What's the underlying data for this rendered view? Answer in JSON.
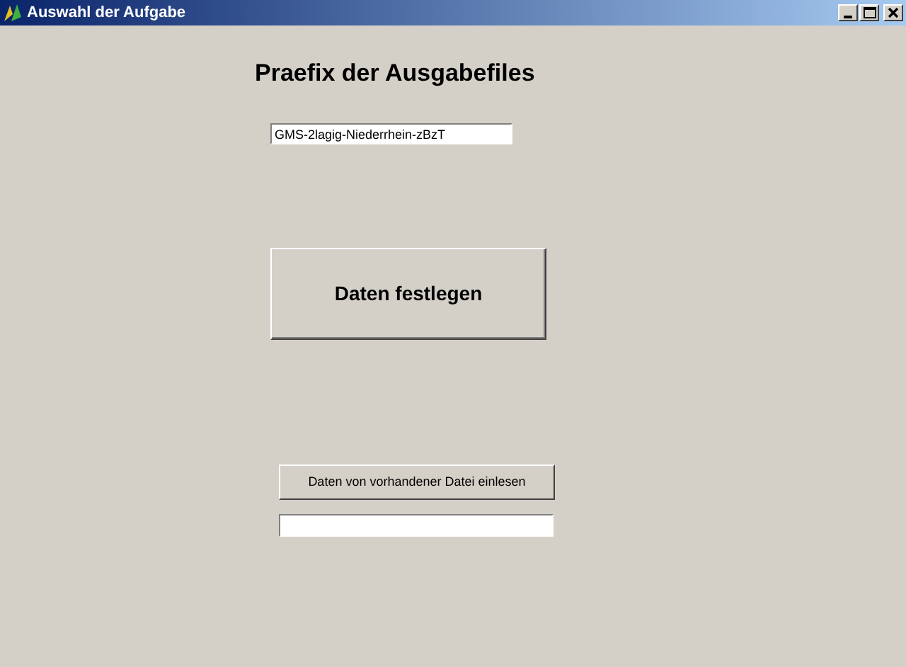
{
  "window": {
    "title": "Auswahl der Aufgabe"
  },
  "heading": "Praefix der Ausgabefiles",
  "prefix_field": {
    "value": "GMS-2lagig-Niederrhein-zBzT"
  },
  "main_button": "Daten festlegen",
  "load_button": "Daten von vorhandener Datei einlesen"
}
